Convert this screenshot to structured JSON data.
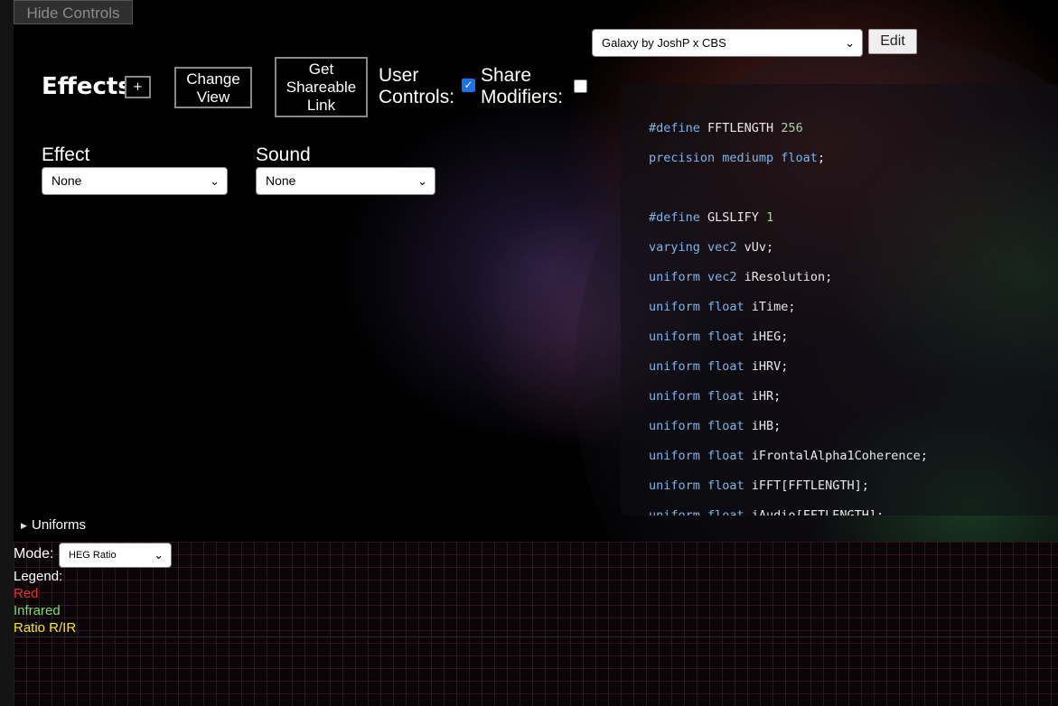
{
  "hide_controls_label": "Hide Controls",
  "preset": {
    "selected": "Galaxy by JoshP x CBS",
    "edit_label": "Edit"
  },
  "header": {
    "title": "Effects",
    "plus_label": "+",
    "change_view_lines": [
      "Change",
      "View"
    ],
    "share_link_lines": [
      "Get",
      "Shareable",
      "Link"
    ],
    "user_controls_lines": [
      "User",
      "Controls:"
    ],
    "user_controls_checked": true,
    "share_modifiers_lines": [
      "Share",
      "Modifiers:"
    ],
    "share_modifiers_checked": false
  },
  "effect": {
    "label": "Effect",
    "selected": "None"
  },
  "sound": {
    "label": "Sound",
    "selected": "None"
  },
  "code": {
    "lines": [
      [
        [
          "kw",
          "#define "
        ],
        [
          "t",
          "FFTLENGTH "
        ],
        [
          "num",
          "256"
        ]
      ],
      [
        [
          "kw",
          "precision mediump float"
        ],
        [
          "t",
          ";"
        ]
      ],
      [],
      [
        [
          "kw",
          "#define "
        ],
        [
          "t",
          "GLSLIFY "
        ],
        [
          "num",
          "1"
        ]
      ],
      [
        [
          "kw",
          "varying vec2 "
        ],
        [
          "t",
          "vUv;"
        ]
      ],
      [
        [
          "kw",
          "uniform vec2 "
        ],
        [
          "t",
          "iResolution;"
        ]
      ],
      [
        [
          "kw",
          "uniform float "
        ],
        [
          "t",
          "iTime;"
        ]
      ],
      [
        [
          "kw",
          "uniform float "
        ],
        [
          "t",
          "iHEG;"
        ]
      ],
      [
        [
          "kw",
          "uniform float "
        ],
        [
          "t",
          "iHRV;"
        ]
      ],
      [
        [
          "kw",
          "uniform float "
        ],
        [
          "t",
          "iHR;"
        ]
      ],
      [
        [
          "kw",
          "uniform float "
        ],
        [
          "t",
          "iHB;"
        ]
      ],
      [
        [
          "kw",
          "uniform float "
        ],
        [
          "t",
          "iFrontalAlpha1Coherence;"
        ]
      ],
      [
        [
          "kw",
          "uniform float "
        ],
        [
          "t",
          "iFFT[FFTLENGTH];"
        ]
      ],
      [
        [
          "kw",
          "uniform float "
        ],
        [
          "t",
          "iAudio[FFTLENGTH];"
        ]
      ]
    ]
  },
  "uniforms_label": "Uniforms",
  "bottom": {
    "mode_label": "Mode:",
    "mode_selected": "HEG Ratio",
    "legend_title": "Legend:",
    "legend": [
      {
        "label": "Red",
        "color": "#e8331c"
      },
      {
        "label": "Infrared",
        "color": "#77e05a"
      },
      {
        "label": "Ratio R/IR",
        "color": "#f2e81a"
      }
    ]
  }
}
